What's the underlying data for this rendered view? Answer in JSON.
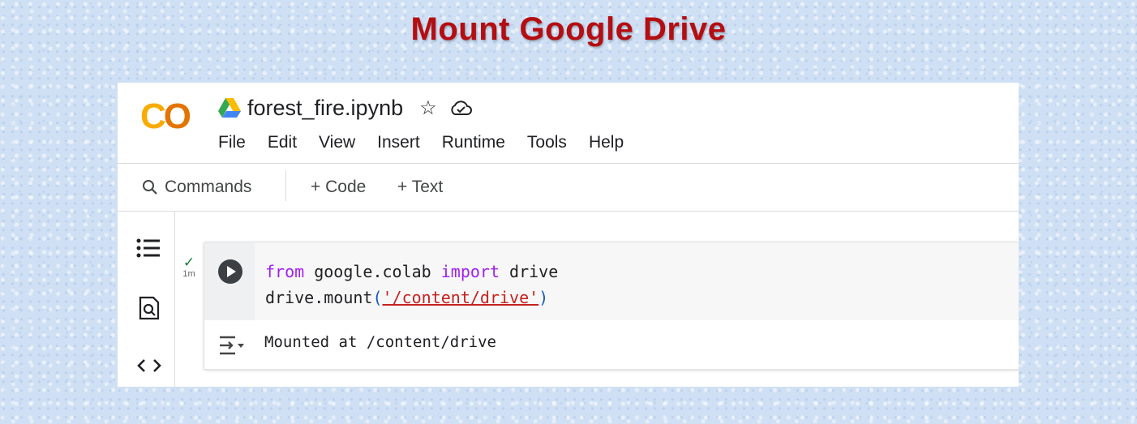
{
  "headline": "Mount Google Drive",
  "app": {
    "logo_text": {
      "c": "C",
      "o": "O"
    },
    "notebook_name": "forest_fire.ipynb",
    "menu": [
      "File",
      "Edit",
      "View",
      "Insert",
      "Runtime",
      "Tools",
      "Help"
    ]
  },
  "toolbar": {
    "commands_label": "Commands",
    "add_code_label": "+ Code",
    "add_text_label": "+ Text"
  },
  "cell": {
    "status_check": "✓",
    "exec_time": "1m",
    "code_line1": {
      "kw_from": "from",
      "module": " google.colab ",
      "kw_import": "import",
      "name": " drive"
    },
    "code_line2": {
      "call": "drive.mount",
      "open": "(",
      "string": "'/content/drive'",
      "close": ")"
    },
    "output": "Mounted at /content/drive"
  },
  "colors": {
    "headline": "#b40d12",
    "logo_c": "#f9ab00",
    "logo_o": "#e37400",
    "keyword": "#a020f0",
    "string": "#c5221f"
  },
  "icons": [
    "google-drive-icon",
    "star-icon",
    "cloud-saved-icon",
    "search-icon",
    "table-of-contents-icon",
    "find-icon",
    "code-snippets-icon",
    "run-cell-icon",
    "output-toggle-icon"
  ]
}
